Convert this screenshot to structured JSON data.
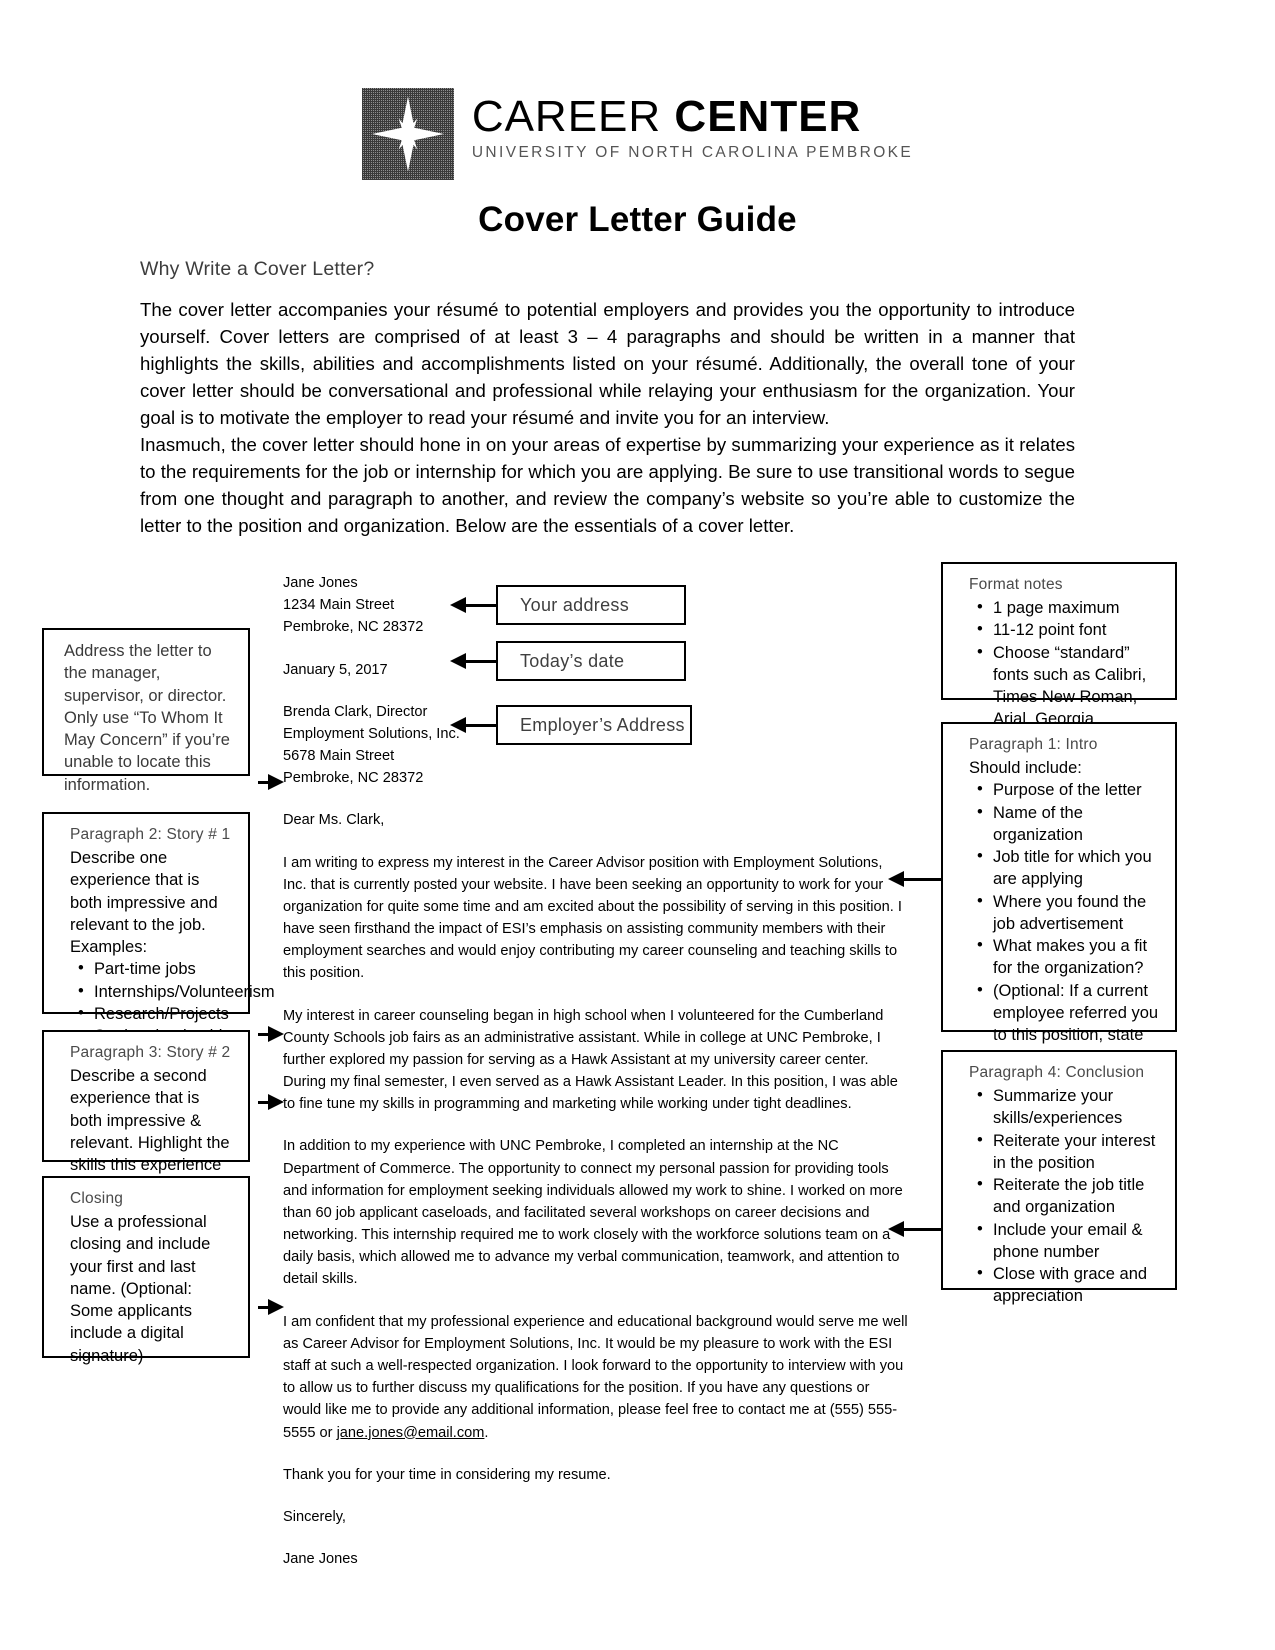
{
  "logo": {
    "title_thin": "CAREER",
    "title_bold": "CENTER",
    "subtitle": "UNIVERSITY OF NORTH CAROLINA PEMBROKE",
    "mark_icon": "compass-star-icon"
  },
  "doc_title": "Cover Letter Guide",
  "intro": {
    "heading": "Why Write a Cover Letter?",
    "paragraph_1": "The cover letter accompanies your résumé to potential employers and provides you the opportunity to introduce yourself. Cover letters are comprised of at least 3 – 4 paragraphs and should be written in a manner that highlights the skills, abilities and accomplishments listed on your résumé. Additionally, the overall tone of your cover letter should be conversational and professional while relaying your enthusiasm for the organization. Your goal is to motivate the employer to read your résumé and invite you for an interview.",
    "paragraph_2": "Inasmuch, the cover letter should hone in on your areas of expertise by summarizing your experience as it relates to the requirements for the job or internship for which you are applying. Be sure to use transitional words to segue from one thought and paragraph to another, and review the company’s website so you’re able to customize the letter to the position and organization. Below are the essentials of a cover letter."
  },
  "labels": {
    "your_address": "Your address",
    "todays_date": "Today’s date",
    "employers_address": "Employer’s Address"
  },
  "letter": {
    "sender": [
      "Jane Jones",
      "1234 Main Street",
      "Pembroke, NC 28372"
    ],
    "date": "January 5, 2017",
    "recipient": [
      "Brenda Clark, Director",
      "Employment Solutions, Inc.",
      "5678 Main Street",
      "Pembroke, NC 28372"
    ],
    "salutation": "Dear Ms. Clark,",
    "body_1": "I am writing to express my interest in the Career Advisor position with Employment Solutions, Inc. that is currently posted your website. I have been seeking an opportunity to work for your organization for quite some time and am excited about the possibility of serving in this position. I have seen firsthand the impact of ESI’s emphasis on assisting community members with their employment searches and would enjoy contributing my career counseling and teaching skills to this position.",
    "body_2": "My interest in career counseling began in high school when I volunteered for the Cumberland County Schools job fairs as an administrative assistant. While in college at UNC Pembroke, I further explored my passion for serving as a Hawk Assistant at my university career center. During my final semester, I even served as a Hawk Assistant Leader. In this position, I was able to fine tune my skills in programming and marketing while working under tight deadlines.",
    "body_3": "In addition to my experience with UNC Pembroke, I completed an internship at the NC Department of Commerce. The opportunity to connect my personal passion for providing tools and information for employment seeking individuals allowed my work to shine. I worked on more than 60 job applicant caseloads, and facilitated several workshops on career decisions and networking. This internship required me to work closely with the workforce solutions team on a daily basis, which allowed me to advance my verbal communication, teamwork, and attention to detail skills.",
    "body_4_pre": "I am confident that my professional experience and educational background would serve me well as Career Advisor for Employment Solutions, Inc. It would be my pleasure to work with the ESI staff at such a well-respected organization. I look forward to the opportunity to interview with you to allow us to further discuss my qualifications for the position. If you have any questions or would like me to provide any additional information, please feel free to contact me at (555) 555-5555 or ",
    "body_4_email": "jane.jones@email.com",
    "body_4_post": ".",
    "thanks": "Thank you for your time in considering my resume.",
    "closing": "Sincerely,",
    "signature": "Jane Jones"
  },
  "callouts": {
    "address_letter": {
      "text": "Address the letter to the manager, supervisor, or director. Only use “To Whom It May Concern” if you’re unable to locate this information."
    },
    "paragraph_2": {
      "title": "Paragraph 2: Story # 1",
      "body": "Describe one experience that is both impressive and relevant to the job. Examples:",
      "bullets": [
        "Part-time jobs",
        "Internships/Volunteerism",
        "Research/Projects",
        "Student leadership"
      ]
    },
    "paragraph_3": {
      "title": "Paragraph 3: Story # 2",
      "body": "Describe a second experience that is both impressive & relevant. Highlight the skills this experience demonstrates."
    },
    "closing": {
      "title": "Closing",
      "body": "Use a professional closing and include your first and last name. (Optional: Some applicants include a digital signature)"
    },
    "format_notes": {
      "title": "Format notes",
      "bullets": [
        "1 page maximum",
        "11-12 point font",
        "Choose “standard” fonts such as Calibri, Times New Roman, Arial, Georgia, Verdana"
      ]
    },
    "paragraph_1": {
      "title": "Paragraph 1: Intro",
      "subtitle": "Should include:",
      "bullets": [
        "Purpose of the letter",
        "Name of the organization",
        "Job title for which you are applying",
        "Where you found the job advertisement",
        "What makes you a fit for the organization?",
        "(Optional: If a current employee referred you to this position, state that and their name here)"
      ]
    },
    "paragraph_4": {
      "title": "Paragraph 4: Conclusion",
      "bullets": [
        "Summarize your skills/experiences",
        "Reiterate your interest in the position",
        "Reiterate the job title and organization",
        "Include your email & phone number",
        "Close with grace and appreciation"
      ]
    }
  }
}
